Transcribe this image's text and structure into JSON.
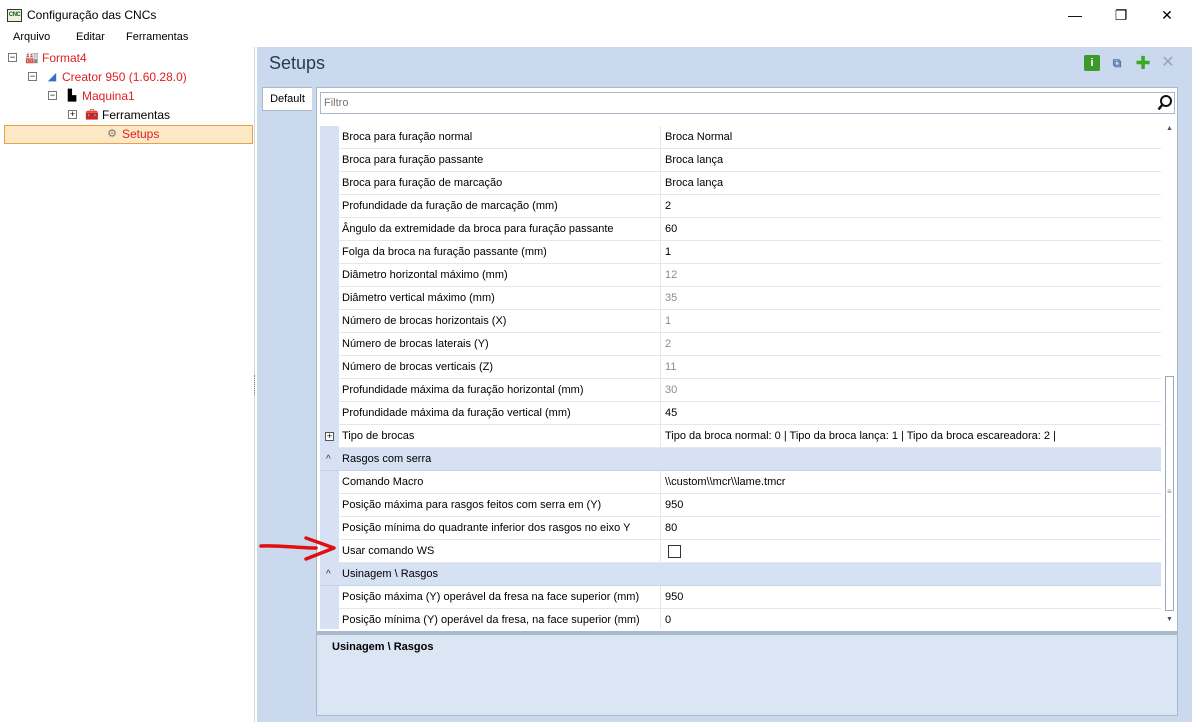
{
  "window": {
    "icon_text": "CNC",
    "title": "Configuração das CNCs",
    "min_glyph": "—",
    "max_glyph": "❐",
    "close_glyph": "✕"
  },
  "menu": [
    "Arquivo",
    "Editar",
    "Ferramentas"
  ],
  "tree": [
    {
      "label": "Format4",
      "level": 0,
      "icon": "factory-icon",
      "glyph": "🏭",
      "expander": "−",
      "color": "red"
    },
    {
      "label": "Creator 950 (1.60.28.0)",
      "level": 1,
      "icon": "machine-icon",
      "glyph": "◢",
      "expander": "−",
      "color": "red"
    },
    {
      "label": "Maquina1",
      "level": 2,
      "icon": "cnc-machine-icon",
      "glyph": "▙",
      "expander": "−",
      "color": "red"
    },
    {
      "label": "Ferramentas",
      "level": 3,
      "icon": "toolbox-icon",
      "glyph": "🧰",
      "expander": "+",
      "color": "black"
    },
    {
      "label": "Setups",
      "level": 4,
      "icon": "gear-icon",
      "glyph": "⚙",
      "expander": "",
      "color": "red",
      "selected": true
    }
  ],
  "main": {
    "title": "Setups",
    "tab": "Default",
    "filter_placeholder": "Filtro",
    "toolbar": {
      "info_glyph": "i",
      "copy_glyph": "⧉",
      "add_glyph": "✚",
      "delete_glyph": "✕"
    }
  },
  "grid": {
    "rows": [
      {
        "type": "prop",
        "name": "Broca para furação normal",
        "value": "Broca Normal",
        "ro": false
      },
      {
        "type": "prop",
        "name": "Broca para furação passante",
        "value": "Broca lança",
        "ro": false
      },
      {
        "type": "prop",
        "name": "Broca para furação de marcação",
        "value": "Broca lança",
        "ro": false
      },
      {
        "type": "prop",
        "name": "Profundidade da furação de marcação (mm)",
        "value": "2",
        "ro": false
      },
      {
        "type": "prop",
        "name": "Ângulo da extremidade da broca para furação passante",
        "value": "60",
        "ro": false
      },
      {
        "type": "prop",
        "name": "Folga da broca na furação passante (mm)",
        "value": "1",
        "ro": false
      },
      {
        "type": "prop",
        "name": "Diâmetro horizontal máximo (mm)",
        "value": "12",
        "ro": true
      },
      {
        "type": "prop",
        "name": "Diâmetro vertical máximo (mm)",
        "value": "35",
        "ro": true
      },
      {
        "type": "prop",
        "name": "Número de brocas horizontais (X)",
        "value": "1",
        "ro": true
      },
      {
        "type": "prop",
        "name": "Número de brocas laterais (Y)",
        "value": "2",
        "ro": true
      },
      {
        "type": "prop",
        "name": "Número de brocas verticais (Z)",
        "value": "11",
        "ro": true
      },
      {
        "type": "prop",
        "name": "Profundidade máxima da furação horizontal (mm)",
        "value": "30",
        "ro": true
      },
      {
        "type": "prop",
        "name": "Profundidade máxima da furação vertical (mm)",
        "value": "45",
        "ro": false
      },
      {
        "type": "prop",
        "name": "Tipo de brocas",
        "value": "Tipo da broca normal: 0 | Tipo da broca lança: 1 | Tipo da broca escareadora: 2 |",
        "ro": false,
        "expandable": true
      },
      {
        "type": "cat",
        "name": "Rasgos com serra"
      },
      {
        "type": "prop",
        "name": "Comando Macro",
        "value": "\\\\custom\\\\mcr\\\\lame.tmcr",
        "ro": false
      },
      {
        "type": "prop",
        "name": "Posição máxima para rasgos feitos com serra em (Y)",
        "value": "950",
        "ro": false
      },
      {
        "type": "prop",
        "name": "Posição mínima do quadrante inferior dos rasgos no eixo Y",
        "value": "80",
        "ro": false
      },
      {
        "type": "check",
        "name": "Usar comando WS",
        "checked": false
      },
      {
        "type": "cat",
        "name": "Usinagem \\ Rasgos"
      },
      {
        "type": "prop",
        "name": "Posição máxima (Y) operável da fresa na face superior (mm)",
        "value": "950",
        "ro": false
      },
      {
        "type": "prop",
        "name": "Posição mínima (Y) operável da fresa, na face superior (mm)",
        "value": "0",
        "ro": false
      }
    ]
  },
  "description": {
    "title": "Usinagem \\ Rasgos"
  },
  "colors": {
    "accent_red": "#e02020",
    "panel_blue": "#cad9ee",
    "selection": "#fde8c5"
  }
}
